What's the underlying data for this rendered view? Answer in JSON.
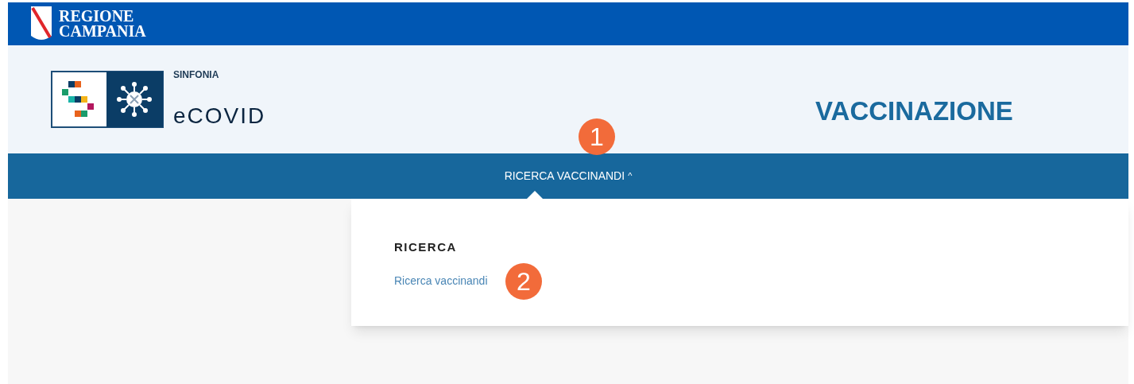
{
  "region_bar": {
    "title_line_1": "REGIONE",
    "title_line_2": "CAMPANIA"
  },
  "header": {
    "brand_small": "SINFONIA",
    "brand_name": "eCOVID",
    "page_title": "VACCINAZIONE"
  },
  "nav": {
    "items": [
      {
        "label": "RICERCA VACCINANDI",
        "caret": "^",
        "expanded": true,
        "marker": "1"
      }
    ]
  },
  "dropdown": {
    "heading": "RICERCA",
    "links": [
      {
        "label": "Ricerca vaccinandi",
        "marker": "2"
      }
    ]
  }
}
